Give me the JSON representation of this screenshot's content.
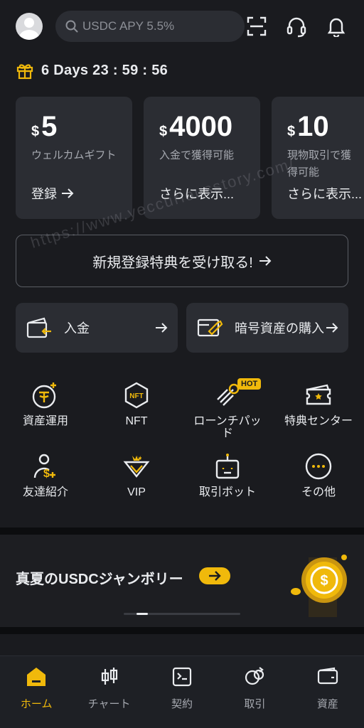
{
  "header": {
    "search_placeholder": "USDC APY 5.5%",
    "icons": [
      "avatar",
      "scan-icon",
      "headset-icon",
      "bell-icon"
    ]
  },
  "countdown": {
    "text": "6 Days 23 : 59 : 56"
  },
  "cards": [
    {
      "currency": "$",
      "amount": "5",
      "desc": "ウェルカムギフト",
      "cta": "登録"
    },
    {
      "currency": "$",
      "amount": "4000",
      "desc": "入金で獲得可能",
      "cta": "さらに表示..."
    },
    {
      "currency": "$",
      "amount": "10",
      "desc": "現物取引で獲得可能",
      "cta": "さらに表示..."
    }
  ],
  "register": {
    "label": "新規登録特典を受け取る!"
  },
  "quick_actions": [
    {
      "label": "入金"
    },
    {
      "label": "暗号資産の購入"
    }
  ],
  "grid": [
    {
      "label": "資産運用"
    },
    {
      "label": "NFT"
    },
    {
      "label": "ローンチパッド",
      "badge": "HOT"
    },
    {
      "label": "特典センター"
    },
    {
      "label": "友達紹介"
    },
    {
      "label": "VIP"
    },
    {
      "label": "取引ボット"
    },
    {
      "label": "その他"
    }
  ],
  "banner": {
    "title": "真夏のUSDCジャンボリー"
  },
  "watermark": "https://www.yeccuriousstory.com/",
  "bottom_nav": [
    {
      "label": "ホーム",
      "active": true
    },
    {
      "label": "チャート"
    },
    {
      "label": "契約"
    },
    {
      "label": "取引"
    },
    {
      "label": "資産"
    }
  ],
  "colors": {
    "accent": "#f0b90b",
    "background": "#1a1b1f",
    "card": "#2b2d33"
  }
}
